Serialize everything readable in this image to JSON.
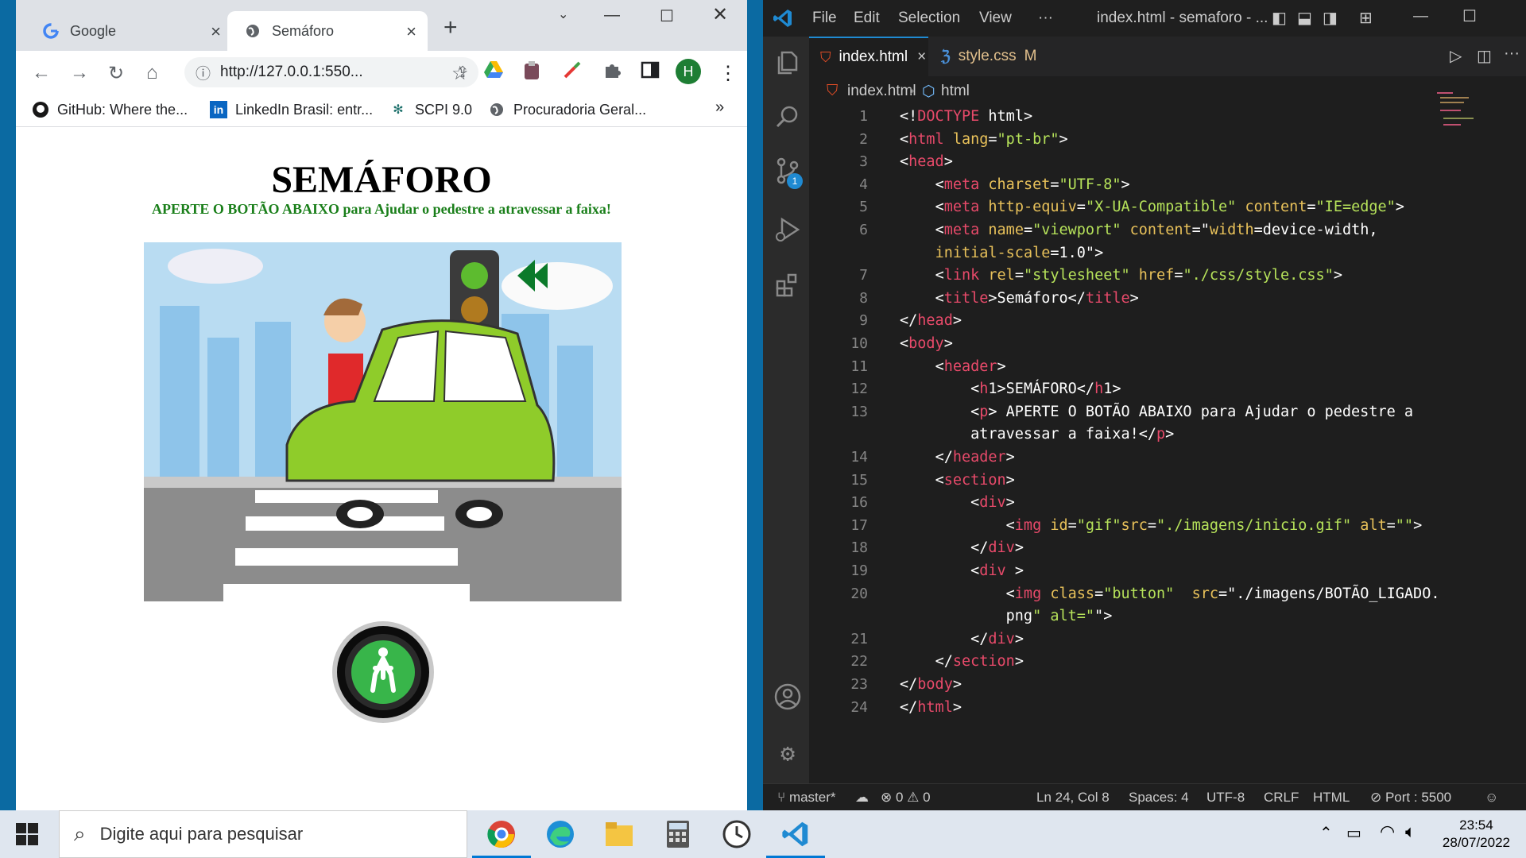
{
  "chrome": {
    "tabs": [
      {
        "title": "Google",
        "icon": "google-icon"
      },
      {
        "title": "Semáforo",
        "icon": "globe-icon"
      }
    ],
    "url": "http://127.0.0.1:550...",
    "bookmarks": [
      {
        "label": "GitHub: Where the...",
        "icon": "github-icon"
      },
      {
        "label": "LinkedIn Brasil: entr...",
        "icon": "linkedin-icon"
      },
      {
        "label": "SCPI 9.0",
        "icon": "scpi-icon"
      },
      {
        "label": "Procuradoria Geral...",
        "icon": "globe-icon"
      }
    ],
    "profile_initial": "H",
    "more_bookmarks": "»"
  },
  "page": {
    "h1": "SEMÁFORO",
    "p": "APERTE O BOTÃO ABAIXO para Ajudar o pedestre a atravessar a faixa!"
  },
  "vscode": {
    "menu": [
      "File",
      "Edit",
      "Selection",
      "View",
      "···"
    ],
    "title": "index.html - semaforo - ...",
    "tabs": [
      {
        "label": "index.html",
        "close": "×"
      },
      {
        "label": "style.css",
        "badge": "M"
      }
    ],
    "breadcrumb": [
      "index.html",
      "html"
    ],
    "scm_badge": "1",
    "line_numbers": [
      "1",
      "2",
      "3",
      "4",
      "5",
      "6",
      "",
      "7",
      "8",
      "9",
      "10",
      "11",
      "12",
      "13",
      "",
      "14",
      "15",
      "16",
      "17",
      "18",
      "19",
      "20",
      "",
      "21",
      "22",
      "23",
      "24"
    ],
    "code": [
      "<!DOCTYPE html>",
      "<html lang=\"pt-br\">",
      "<head>",
      "    <meta charset=\"UTF-8\">",
      "    <meta http-equiv=\"X-UA-Compatible\" content=\"IE=edge\">",
      "    <meta name=\"viewport\" content=\"width=device-width,",
      "    initial-scale=1.0\">",
      "    <link rel=\"stylesheet\" href=\"./css/style.css\">",
      "    <title>Semáforo</title>",
      "</head>",
      "<body>",
      "    <header>",
      "        <h1>SEMÁFORO</h1>",
      "        <p> APERTE O BOTÃO ABAIXO para Ajudar o pedestre a",
      "        atravessar a faixa!</p>",
      "    </header>",
      "    <section>",
      "        <div>",
      "            <img id=\"gif\"src=\"./imagens/inicio.gif\" alt=\"\">",
      "        </div>",
      "        <div >",
      "            <img class=\"button\"  src=\"./imagens/BOTÃO_LIGADO.",
      "            png\" alt=\"\">",
      "        </div>",
      "    </section>",
      "</body>",
      "</html>"
    ],
    "status": {
      "branch": "master*",
      "problems": "0",
      "warnings": "0",
      "position": "Ln 24, Col 8",
      "spaces": "Spaces: 4",
      "encoding": "UTF-8",
      "eol": "CRLF",
      "language": "HTML",
      "port": "Port : 5500"
    }
  },
  "taskbar": {
    "search_placeholder": "Digite aqui para pesquisar",
    "time": "23:54",
    "date": "28/07/2022"
  }
}
